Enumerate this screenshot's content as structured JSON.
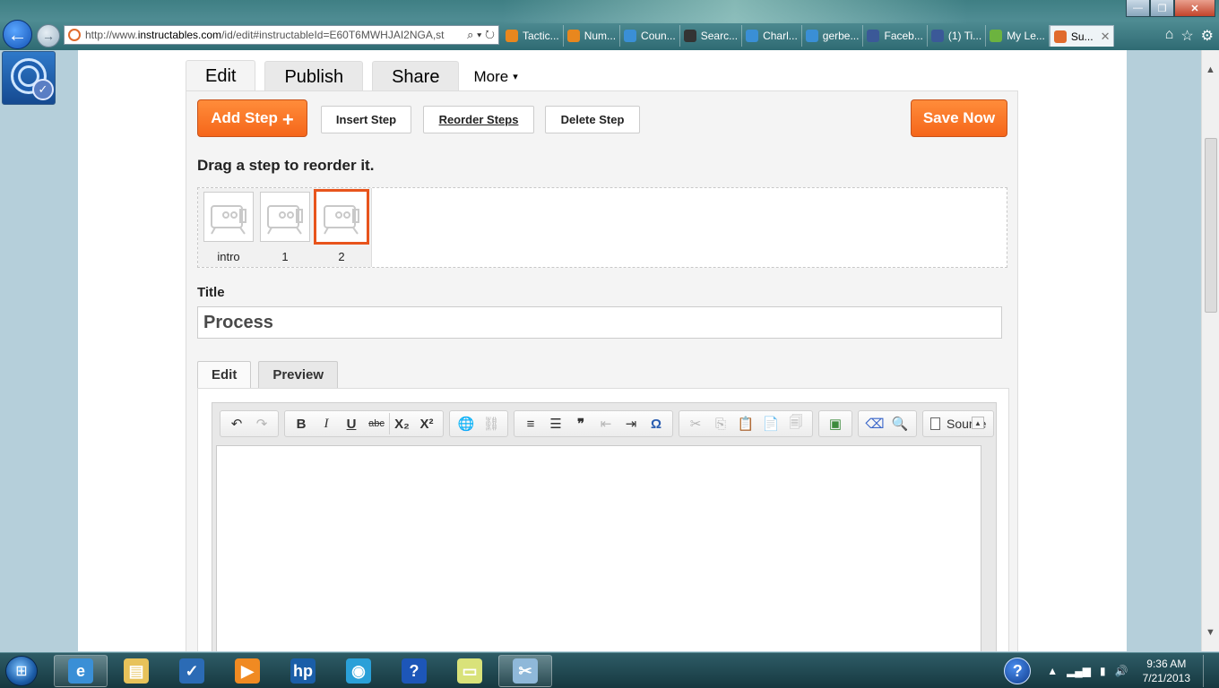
{
  "browser": {
    "url_prefix": "http://www.",
    "url_host": "instructables.com",
    "url_rest": "/id/edit#instructableId=E60T6MWHJAI2NGA,st",
    "address_tools": "⌕ ▾ ↻",
    "tabs": [
      {
        "label": "Tactic...",
        "icon_color": "#e8871e",
        "icon": "fire-icon"
      },
      {
        "label": "Num...",
        "icon_color": "#e8871e",
        "icon": "fire-icon"
      },
      {
        "label": "Coun...",
        "icon_color": "#3a8fd6",
        "icon": "ie-icon"
      },
      {
        "label": "Searc...",
        "icon_color": "#333333",
        "icon": "shield-icon"
      },
      {
        "label": "Charl...",
        "icon_color": "#3a8fd6",
        "icon": "ie-icon"
      },
      {
        "label": "gerbe...",
        "icon_color": "#3a8fd6",
        "icon": "ie-icon"
      },
      {
        "label": "Faceb...",
        "icon_color": "#3b5998",
        "icon": "facebook-icon"
      },
      {
        "label": "(1) Ti...",
        "icon_color": "#3b5998",
        "icon": "facebook-icon"
      },
      {
        "label": "My Le...",
        "icon_color": "#6cb33f",
        "icon": "square-icon"
      },
      {
        "label": "Su...",
        "icon_color": "#e06a2c",
        "icon": "instructables-icon",
        "active": true
      }
    ],
    "tab_close": "✕",
    "home_glyph": "⌂",
    "star_glyph": "☆",
    "gear_glyph": "⚙",
    "back_glyph": "←",
    "forward_glyph": "→",
    "min_glyph": "—",
    "max_glyph": "❐",
    "close_glyph": "✕"
  },
  "editor": {
    "top_tabs": {
      "edit": "Edit",
      "publish": "Publish",
      "share": "Share",
      "more": "More",
      "more_caret": "▾"
    },
    "buttons": {
      "add_step": "Add Step",
      "add_step_plus": "+",
      "insert_step": "Insert Step",
      "reorder_steps": "Reorder Steps",
      "delete_step": "Delete Step",
      "save_now": "Save Now"
    },
    "drag_hint": "Drag a step to reorder it.",
    "steps": [
      {
        "label": "intro"
      },
      {
        "label": "1"
      },
      {
        "label": "2",
        "selected": true
      }
    ],
    "title_label": "Title",
    "title_value": "Process",
    "sub_tabs": {
      "edit": "Edit",
      "preview": "Preview"
    },
    "toolbar": {
      "undo": "↶",
      "redo": "↷",
      "bold": "B",
      "italic": "I",
      "underline": "U",
      "strike": "abc",
      "subscript": "X₂",
      "superscript": "X²",
      "link": "🌐",
      "unlink": "⛓",
      "numbered_list": "≡",
      "bulleted_list": "☰",
      "blockquote": "❞",
      "outdent": "⇤",
      "indent": "⇥",
      "special_char": "Ω",
      "cut": "✂",
      "copy": "⎘",
      "paste": "📋",
      "paste_text": "📄",
      "paste_word": "🗐",
      "image": "▣",
      "eraser": "⌫",
      "find": "🔍",
      "source": "Source",
      "collapse": "▲"
    }
  },
  "taskbar": {
    "start_glyph": "⊞",
    "clock_time": "9:36 AM",
    "clock_date": "7/21/2013",
    "help_glyph": "?",
    "tray_up": "▲",
    "tray_signal": "▂▄▆",
    "tray_battery": "▮",
    "tray_volume": "🔊",
    "apps": [
      {
        "name": "ie",
        "glyph": "e",
        "color": "#3a8fd6",
        "open": true
      },
      {
        "name": "explorer",
        "glyph": "▤",
        "color": "#e7c25a",
        "open": false
      },
      {
        "name": "checkmark-app",
        "glyph": "✓",
        "color": "#2b6bb5",
        "open": false
      },
      {
        "name": "media-player",
        "glyph": "▶",
        "color": "#f08a22",
        "open": false
      },
      {
        "name": "hp",
        "glyph": "hp",
        "color": "#1a5ea8",
        "open": false
      },
      {
        "name": "globe",
        "glyph": "◉",
        "color": "#2aa0d8",
        "open": false
      },
      {
        "name": "help",
        "glyph": "?",
        "color": "#1d56b8",
        "open": false
      },
      {
        "name": "notes",
        "glyph": "▭",
        "color": "#d9e27a",
        "open": false
      },
      {
        "name": "snipping",
        "glyph": "✂",
        "color": "#8fb8d9",
        "open": true
      }
    ]
  }
}
